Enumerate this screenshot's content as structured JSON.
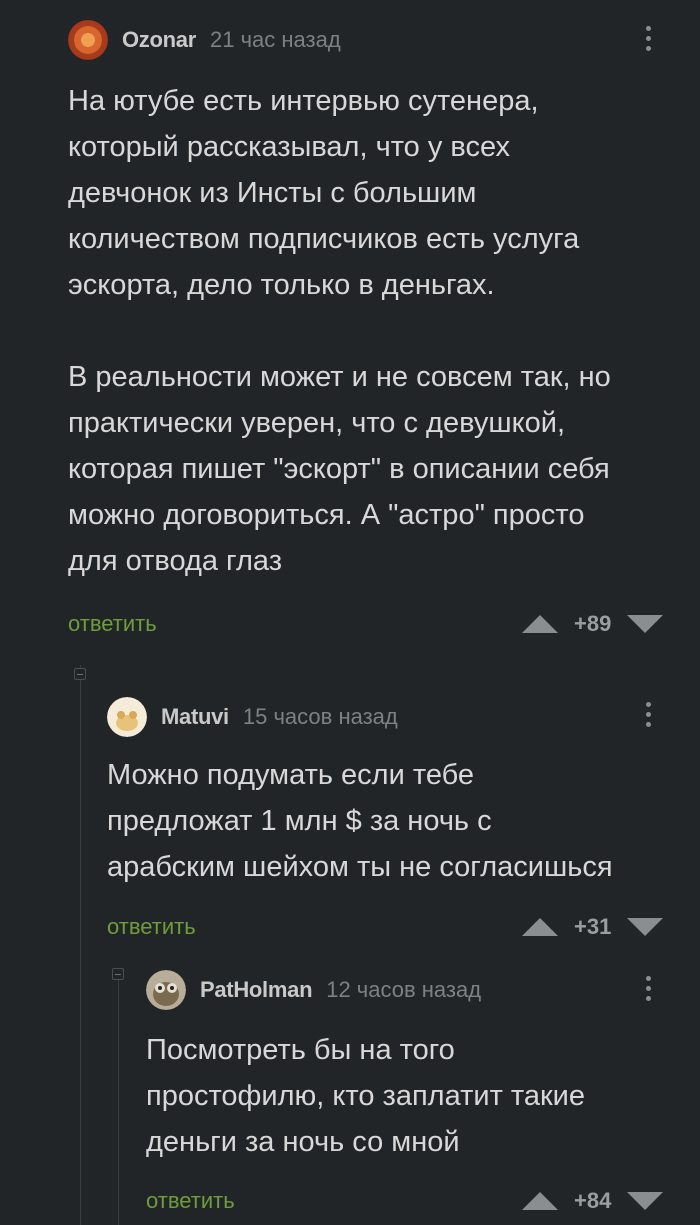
{
  "comments": [
    {
      "username": "Ozonar",
      "timestamp": "21 час назад",
      "avatar_color": "#c8502a",
      "text_lines": [
        "На ютубе есть интервью сутенера,",
        "который рассказывал, что у всех",
        "девчонок из Инсты с большим",
        "количеством подписчиков есть услуга",
        "эскорта, дело только в деньгах.",
        "",
        "В реальности может и не совсем так, но",
        "практически уверен, что с девушкой,",
        "которая пишет \"эскорт\" в описании себя",
        "можно договориться. А \"астро\" просто",
        "для отвода глаз"
      ],
      "reply_label": "ответить",
      "score": "+89"
    },
    {
      "username": "Matuvi",
      "timestamp": "15 часов назад",
      "avatar_color": "#e9c27a",
      "text_lines": [
        "Можно подумать если тебе",
        "предложат 1 млн $ за ночь с",
        "арабским шейхом ты не согласишься"
      ],
      "reply_label": "ответить",
      "score": "+31"
    },
    {
      "username": "PatHolman",
      "timestamp": "12 часов назад",
      "avatar_color": "#8a7a5a",
      "text_lines": [
        "Посмотреть бы на того",
        "простофилю, кто заплатит такие",
        "деньги за ночь со мной"
      ],
      "reply_label": "ответить",
      "score": "+84"
    }
  ],
  "colors": {
    "background": "#222527",
    "reply_green": "#6f9c3c",
    "muted": "#7d8184"
  }
}
